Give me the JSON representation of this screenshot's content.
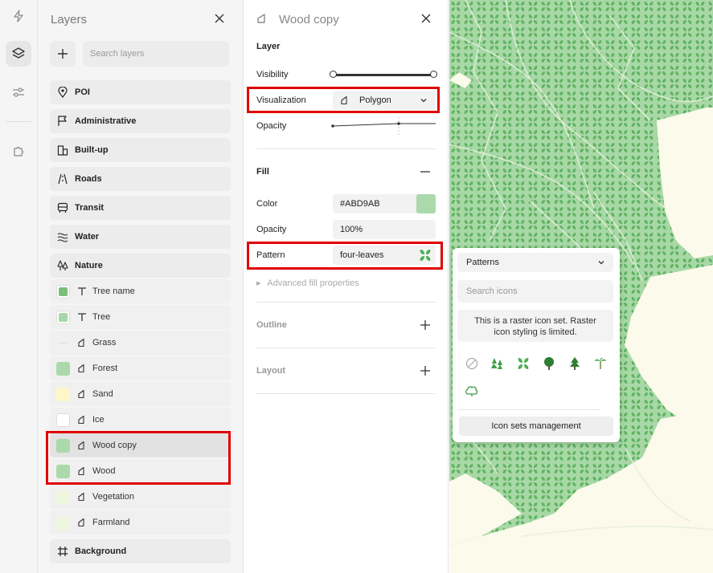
{
  "rail": {
    "items": [
      {
        "icon": "bolt-icon"
      },
      {
        "icon": "layers-icon",
        "active": true
      },
      {
        "icon": "sliders-icon"
      },
      {
        "icon": "puzzle-icon"
      }
    ]
  },
  "layers_panel": {
    "title": "Layers",
    "search_placeholder": "Search layers",
    "groups": [
      {
        "label": "POI",
        "icon": "map-pin-icon"
      },
      {
        "label": "Administrative",
        "icon": "flag-icon"
      },
      {
        "label": "Built-up",
        "icon": "buildings-icon"
      },
      {
        "label": "Roads",
        "icon": "road-icon"
      },
      {
        "label": "Transit",
        "icon": "bus-icon"
      },
      {
        "label": "Water",
        "icon": "waves-icon"
      },
      {
        "label": "Nature",
        "icon": "trees-icon"
      }
    ],
    "nature_items": [
      {
        "label": "Tree name",
        "type": "text",
        "color": "#7cbf7a"
      },
      {
        "label": "Tree",
        "type": "text",
        "color": "#a9d6a6"
      },
      {
        "label": "Grass",
        "type": "polygon",
        "color": null
      },
      {
        "label": "Forest",
        "type": "polygon",
        "color": "#abd9ab"
      },
      {
        "label": "Sand",
        "type": "polygon",
        "color": "#fdf6c9"
      },
      {
        "label": "Ice",
        "type": "polygon",
        "color": "#ffffff"
      },
      {
        "label": "Wood copy",
        "type": "polygon",
        "color": "#abd9ab",
        "selected": true
      },
      {
        "label": "Wood",
        "type": "polygon",
        "color": "#abd9ab"
      },
      {
        "label": "Vegetation",
        "type": "polygon",
        "color": "#eef6e0"
      },
      {
        "label": "Farmland",
        "type": "polygon",
        "color": "#eef6e0"
      }
    ],
    "background": {
      "label": "Background",
      "icon": "frame-icon"
    }
  },
  "properties": {
    "title": "Wood copy",
    "layer_section": "Layer",
    "visibility_label": "Visibility",
    "visualization_label": "Visualization",
    "visualization_value": "Polygon",
    "opacity_label": "Opacity",
    "fill_section": "Fill",
    "color_label": "Color",
    "color_value": "#ABD9AB",
    "fill_opacity_label": "Opacity",
    "fill_opacity_value": "100%",
    "pattern_label": "Pattern",
    "pattern_value": "four-leaves",
    "advanced_label": "Advanced fill properties",
    "outline_section": "Outline",
    "layout_section": "Layout"
  },
  "patterns_popup": {
    "header": "Patterns",
    "search_placeholder": "Search icons",
    "note": "This is a raster icon set. Raster icon styling is limited.",
    "icons": [
      "none-icon",
      "pine-trees-icon",
      "four-leaves-icon",
      "deciduous-tree-icon",
      "conifer-icon",
      "palm-icon",
      "bush-icon"
    ],
    "management_label": "Icon sets management"
  },
  "colors": {
    "highlight": "#e00000",
    "map_green": "#86c98a",
    "map_land": "#fbfaeb",
    "fill": "#ABD9AB"
  }
}
